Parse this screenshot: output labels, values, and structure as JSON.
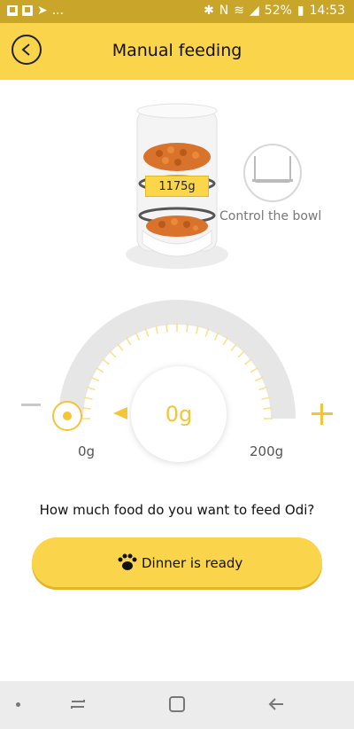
{
  "status_bar": {
    "battery": "52%",
    "time": "14:53",
    "dots": "..."
  },
  "header": {
    "title": "Manual feeding"
  },
  "feeder": {
    "weight": "1175g",
    "control_label": "Control the bowl"
  },
  "gauge": {
    "value": "0g",
    "min_label": "0g",
    "max_label": "200g",
    "level": 0
  },
  "question": "How much food do you want to feed Odi?",
  "feed_button": {
    "label": "Dinner is ready"
  },
  "colors": {
    "accent": "#fad44a",
    "gauge_yellow": "#f5c437",
    "track": "#e6e6e6"
  }
}
